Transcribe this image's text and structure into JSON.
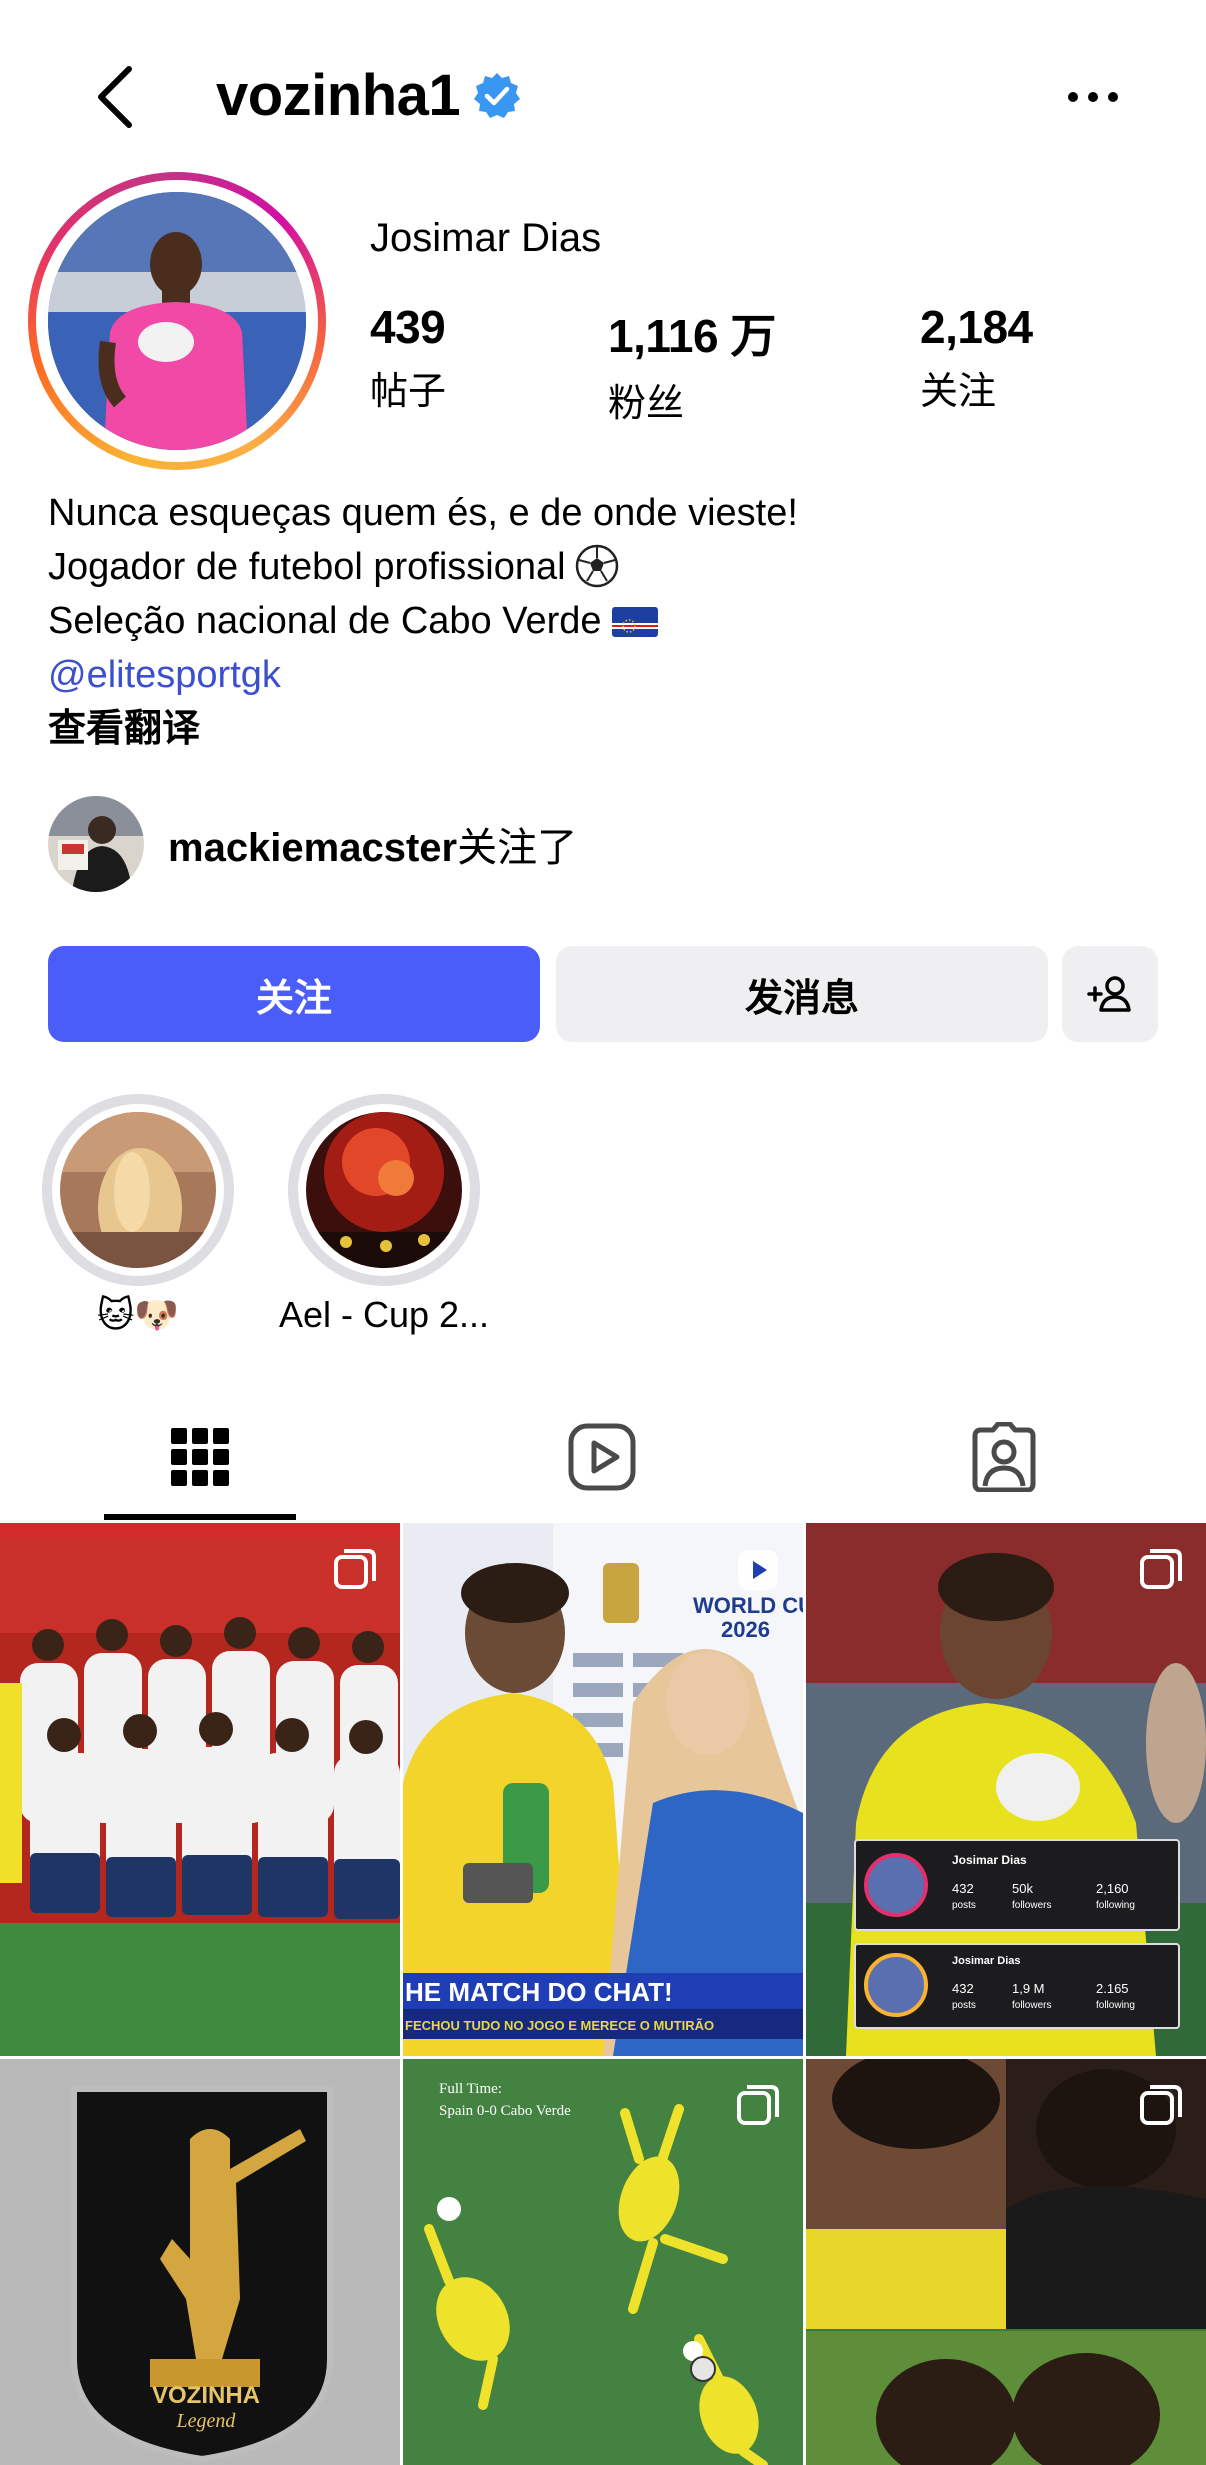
{
  "header": {
    "username": "vozinha1",
    "back_icon": "chevron-left-icon",
    "verified_icon": "verified-badge-icon",
    "more_icon": "ellipsis-icon"
  },
  "profile": {
    "full_name": "Josimar Dias",
    "stats": [
      {
        "value": "439",
        "label": "帖子"
      },
      {
        "value": "1,116 万",
        "label": "粉丝"
      },
      {
        "value": "2,184",
        "label": "关注"
      }
    ],
    "bio": {
      "line1": "Nunca esqueças quem és, e de onde vieste!",
      "line2": "Jogador de futebol profissional",
      "line3": "Seleção nacional de Cabo Verde",
      "link": "@elitesportgk",
      "translate": "查看翻译"
    },
    "followed_by": {
      "name": "mackiemacster",
      "suffix": "关注了"
    }
  },
  "actions": {
    "follow": "关注",
    "message": "发消息",
    "suggest_icon": "add-person-icon"
  },
  "highlights": [
    {
      "label": "🐱🐶"
    },
    {
      "label": "Ael - Cup 2..."
    }
  ],
  "tabs": [
    {
      "name": "posts",
      "icon": "grid-icon",
      "active": true
    },
    {
      "name": "reels",
      "icon": "play-square-icon",
      "active": false
    },
    {
      "name": "tagged",
      "icon": "tagged-person-icon",
      "active": false
    }
  ],
  "posts": [
    {
      "type": "carousel",
      "overlay_text": ""
    },
    {
      "type": "reel",
      "overlay_text": "HE MATCH DO CHAT!",
      "overlay_sub": "FECHOU TUDO NO JOGO E MERECE O MUTIRÃO",
      "corner_text": "WORLD CU\n2026"
    },
    {
      "type": "carousel",
      "card1_name": "Josimar Dias",
      "card1_stats": [
        {
          "v": "432",
          "l": "posts"
        },
        {
          "v": "50k",
          "l": "followers"
        },
        {
          "v": "2,160",
          "l": "following"
        }
      ],
      "card2_name": "Josimar Dias",
      "card2_stats": [
        {
          "v": "432",
          "l": "posts"
        },
        {
          "v": "1,9 M",
          "l": "followers"
        },
        {
          "v": "2.165",
          "l": "following"
        }
      ]
    },
    {
      "type": "image",
      "overlay_text": "VOZINHA",
      "overlay_sub": "Legend"
    },
    {
      "type": "carousel",
      "overlay_text": "Full Time:",
      "overlay_sub": "Spain 0-0 Cabo Verde"
    },
    {
      "type": "carousel",
      "overlay_text": ""
    }
  ],
  "colors": {
    "follow_button": "#4a5df9",
    "secondary_button": "#efeff1",
    "link": "#3b4fcf",
    "verified": "#3897f0"
  }
}
